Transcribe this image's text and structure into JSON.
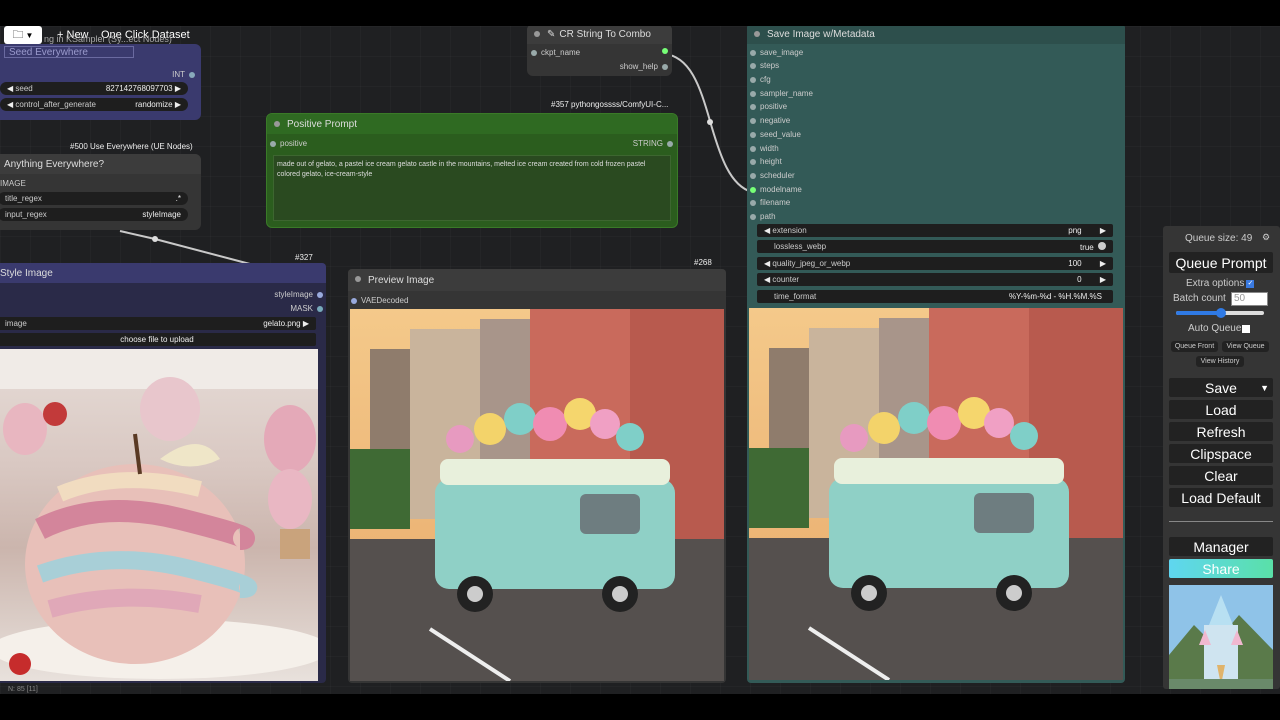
{
  "topbar": {
    "new_label": "New",
    "dataset_label": "One Click Dataset",
    "partial_title": "ng in KSampler (Sy...ect Nodes)"
  },
  "seed_node": {
    "title": "Seed Everywhere",
    "output": "INT",
    "seed_label": "seed",
    "seed_value": "827142768097703",
    "cag_label": "control_after_generate",
    "cag_value": "randomize"
  },
  "ue_node": {
    "tag": "#500 Use Everywhere (UE Nodes)",
    "title": "Anything Everywhere?",
    "input": "IMAGE",
    "title_regex_label": "title_regex",
    "title_regex_value": ".*",
    "input_regex_label": "input_regex",
    "input_regex_value": "styleImage"
  },
  "combo_node": {
    "title": "CR String To Combo",
    "input": "ckpt_name",
    "output": "show_help"
  },
  "prompt_node": {
    "tag": "#357 pythongossss/ComfyUI-C...",
    "title": "Positive Prompt",
    "input": "positive",
    "output": "STRING",
    "text": "made out of gelato, a pastel ice cream gelato castle in the mountains, melted ice cream created from cold frozen pastel colored gelato, ice-cream-style"
  },
  "style_node": {
    "tag": "#327",
    "title": "Style Image",
    "out1": "styleImage",
    "out2": "MASK",
    "image_label": "image",
    "image_value": "gelato.png",
    "upload_label": "choose file to upload"
  },
  "preview_node": {
    "tag": "#268",
    "title": "Preview Image",
    "input": "VAEDecoded"
  },
  "save_node": {
    "title": "Save Image w/Metadata",
    "inputs": [
      "save_image",
      "steps",
      "cfg",
      "sampler_name",
      "positive",
      "negative",
      "seed_value",
      "width",
      "height",
      "scheduler",
      "modelname",
      "filename",
      "path"
    ],
    "w_extension_label": "extension",
    "w_extension_value": "png",
    "w_lossless_label": "lossless_webp",
    "w_lossless_value": "true",
    "w_quality_label": "quality_jpeg_or_webp",
    "w_quality_value": "100",
    "w_counter_label": "counter",
    "w_counter_value": "0",
    "w_timefmt_label": "time_format",
    "w_timefmt_value": "%Y-%m-%d - %H.%M.%S"
  },
  "queue_panel": {
    "queue_size": "Queue size: 49",
    "queue_prompt": "Queue Prompt",
    "extra_options": "Extra options",
    "batch_count_label": "Batch count",
    "batch_count_value": "50",
    "auto_queue": "Auto Queue",
    "queue_front": "Queue Front",
    "view_queue": "View Queue",
    "view_history": "View History",
    "save": "Save",
    "load": "Load",
    "refresh": "Refresh",
    "clipspace": "Clipspace",
    "clear": "Clear",
    "load_default": "Load Default",
    "manager": "Manager",
    "share": "Share"
  },
  "status": {
    "text": "N: 85 [11]"
  },
  "colors": {
    "prompt_green": "#2b5d1e",
    "seed_blue": "#3a3a6e",
    "save_teal": "#335a57",
    "share_gradient": "#55e0c8"
  }
}
